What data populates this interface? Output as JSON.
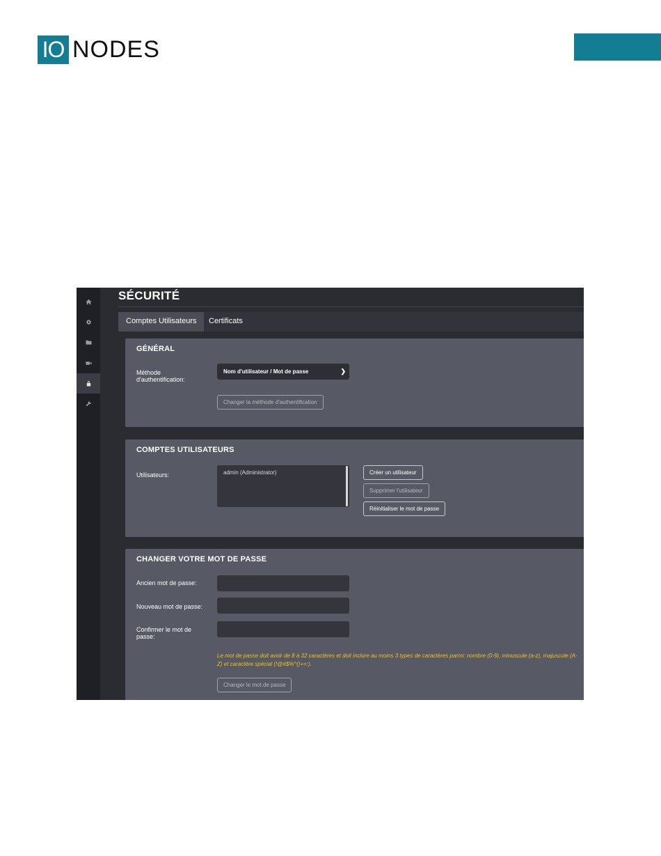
{
  "document": {
    "logo_mark": "IO",
    "logo_text": "NODES",
    "brand_color": "#137d93"
  },
  "sidebar": {
    "items": [
      {
        "icon": "home-icon"
      },
      {
        "icon": "gear-icon"
      },
      {
        "icon": "folder-icon"
      },
      {
        "icon": "camera-icon"
      },
      {
        "icon": "lock-icon",
        "active": true
      },
      {
        "icon": "wrench-icon"
      }
    ]
  },
  "page": {
    "title": "SÉCURITÉ",
    "tabs": [
      {
        "label": "Comptes Utilisateurs",
        "active": true
      },
      {
        "label": "Certificats",
        "active": false
      }
    ]
  },
  "general": {
    "title": "GÉNÉRAL",
    "auth_label": "Méthode d'authentification:",
    "auth_value": "Nom d'utilisateur / Mot de passe",
    "change_auth_button": "Changer la méthode d'authentification"
  },
  "accounts": {
    "title": "COMPTES UTILISATEURS",
    "users_label": "Utilisateurs:",
    "users": [
      "admin   (Administrator)"
    ],
    "create_button": "Créer un utilisateur",
    "delete_button": "Supprimer l'utilisateur",
    "reset_button": "Réinitialiser le mot de passe"
  },
  "password": {
    "title": "CHANGER VOTRE MOT DE PASSE",
    "old_label": "Ancien mot de passe:",
    "new_label": "Nouveau mot de passe:",
    "confirm_label": "Confirmer le mot de passe:",
    "old_value": "",
    "new_value": "",
    "confirm_value": "",
    "note": "Le mot de passe doit avoir de 8 à 32 caractères et doit inclure au moins 3 types de caractères parmi: nombre (0-9), minuscule (a-z), majuscule (A-Z) et caractère spécial (!@#$%^()+=:).",
    "change_button": "Changer le mot de passe",
    "warning_color": "#f2c21a"
  }
}
